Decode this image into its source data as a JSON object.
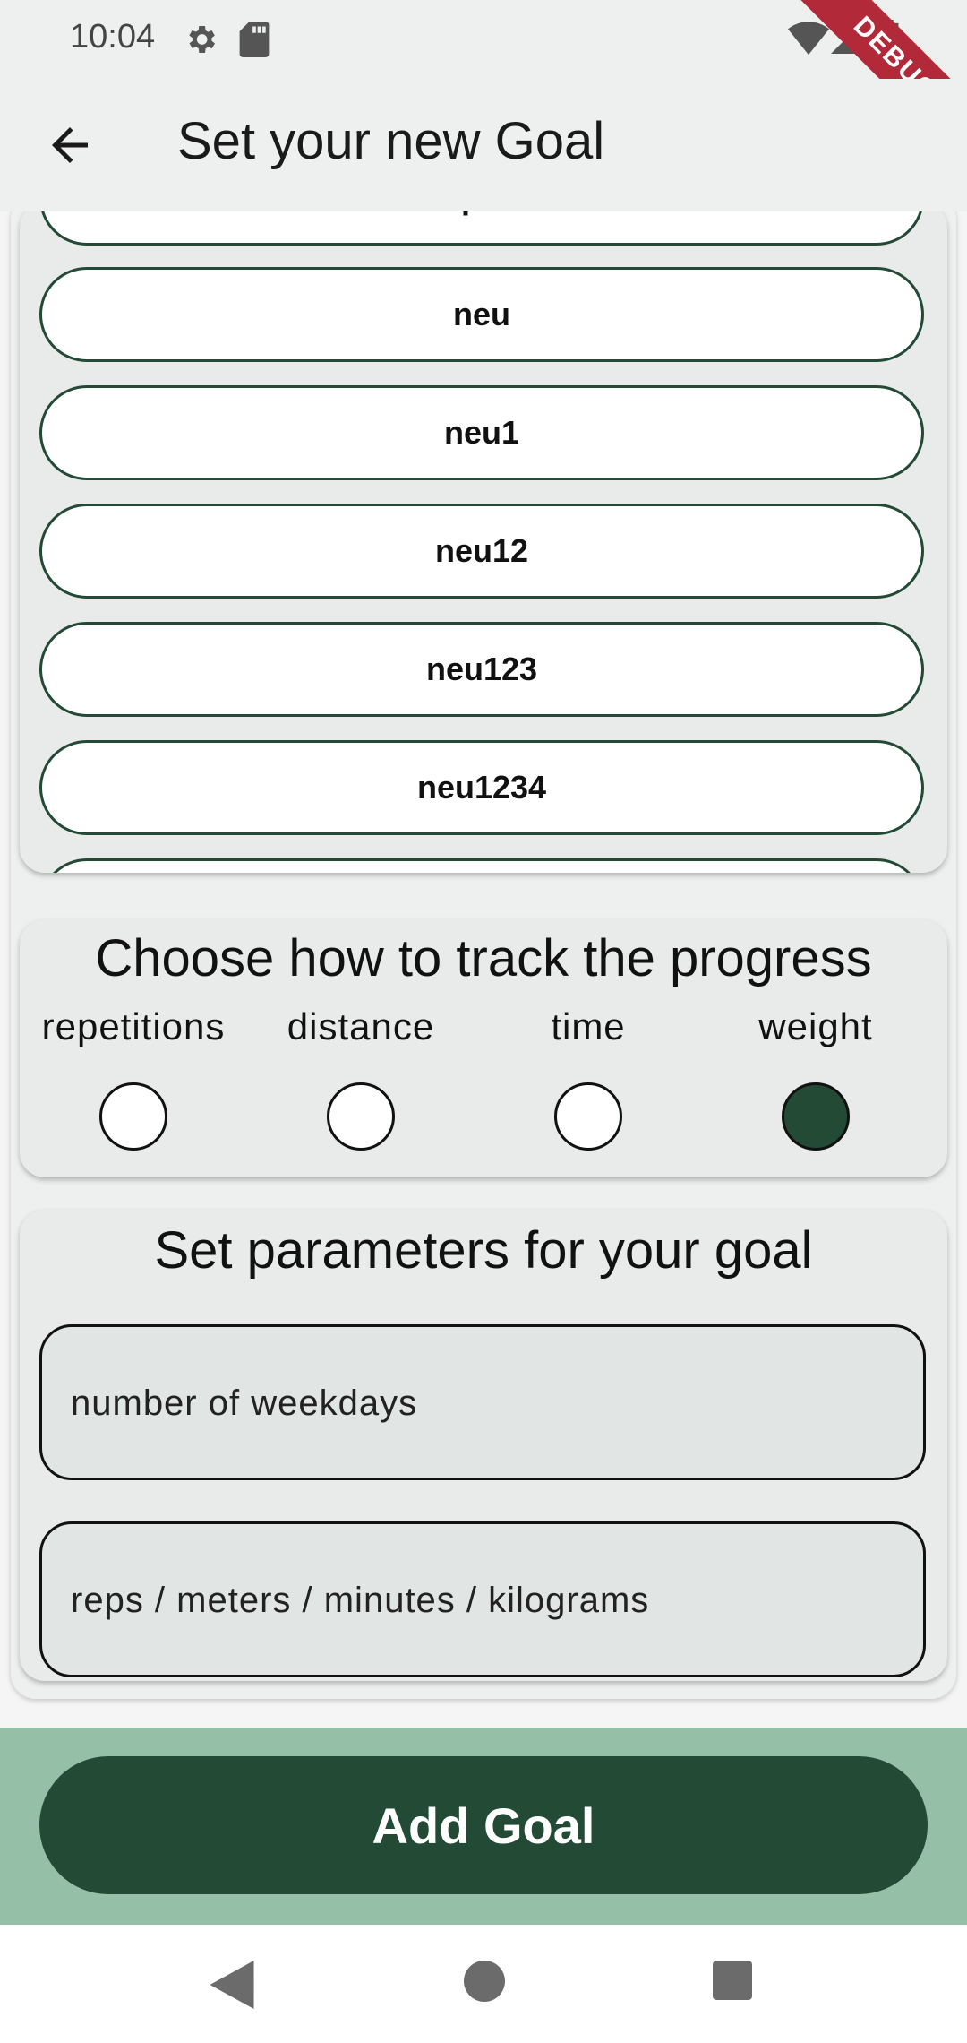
{
  "status_bar": {
    "time": "10:04",
    "icons": [
      "gear-icon",
      "sd-card-icon",
      "wifi-icon",
      "cell-signal-icon",
      "battery-icon"
    ],
    "debug_banner": "DEBUG"
  },
  "app_bar": {
    "back_icon": "arrow-left-icon",
    "title": "Set your new Goal"
  },
  "categories": {
    "items": [
      {
        "label": "Sport"
      },
      {
        "label": "neu"
      },
      {
        "label": "neu1"
      },
      {
        "label": "neu12"
      },
      {
        "label": "neu123"
      },
      {
        "label": "neu1234"
      },
      {
        "label": ""
      }
    ]
  },
  "tracking": {
    "heading": "Choose how to track the progress",
    "options": [
      {
        "label": "repetitions",
        "selected": false
      },
      {
        "label": "distance",
        "selected": false
      },
      {
        "label": "time",
        "selected": false
      },
      {
        "label": "weight",
        "selected": true
      }
    ]
  },
  "parameters": {
    "heading": "Set parameters for your goal",
    "weekdays_placeholder": "number of weekdays",
    "amount_placeholder": "reps / meters / minutes / kilograms"
  },
  "add_button": {
    "label": "Add Goal"
  },
  "colors": {
    "primary": "#234a34",
    "bottom_bar": "#96bfa7",
    "surface": "#e8ebe9",
    "debug": "#b22a3a"
  },
  "nav_bar": {
    "icons": [
      "back-triangle-icon",
      "home-circle-icon",
      "recents-square-icon"
    ]
  }
}
